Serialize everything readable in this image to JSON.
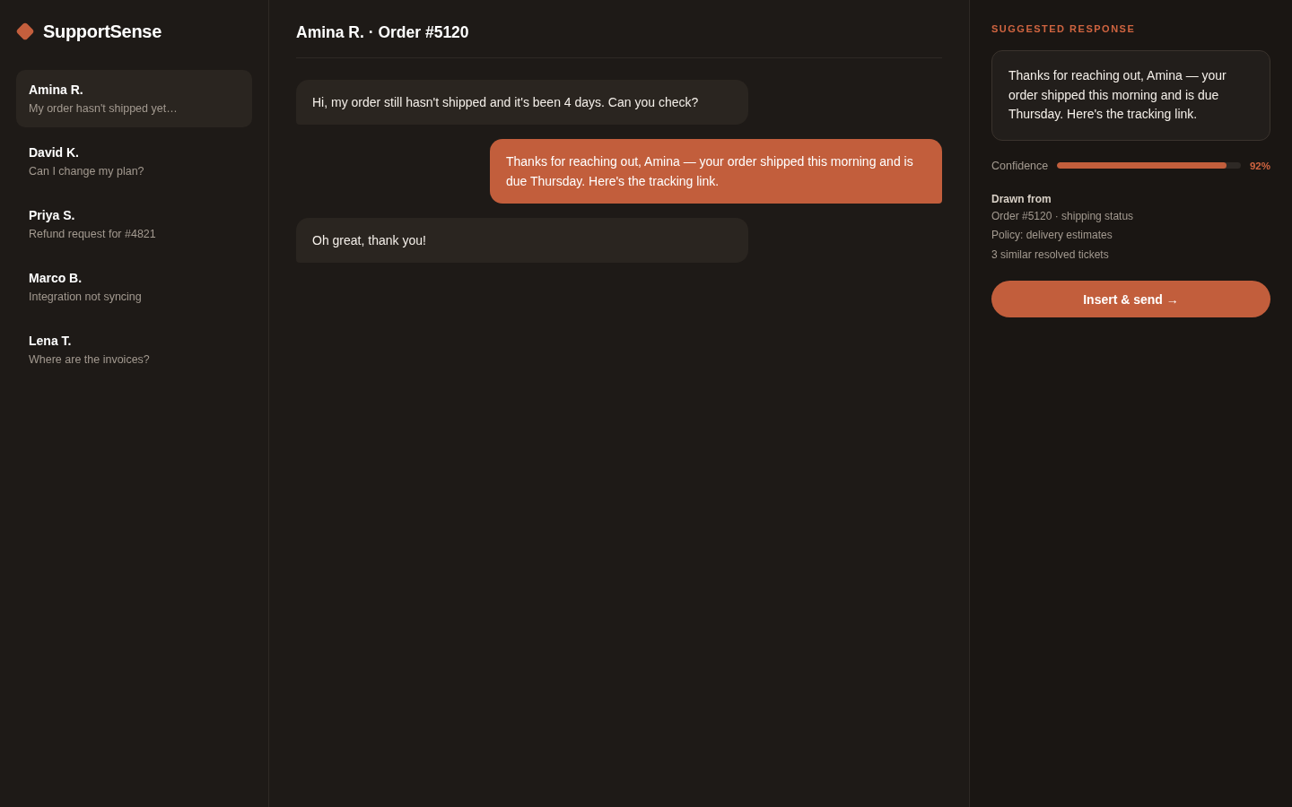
{
  "brand": {
    "name": "SupportSense"
  },
  "conversations": [
    {
      "name": "Amina R.",
      "preview": "My order hasn't shipped yet…",
      "selected": true
    },
    {
      "name": "David K.",
      "preview": "Can I change my plan?",
      "selected": false
    },
    {
      "name": "Priya S.",
      "preview": "Refund request for #4821",
      "selected": false
    },
    {
      "name": "Marco B.",
      "preview": "Integration not syncing",
      "selected": false
    },
    {
      "name": "Lena T.",
      "preview": "Where are the invoices?",
      "selected": false
    }
  ],
  "thread": {
    "title": "Amina R. · Order #5120",
    "messages": [
      {
        "kind": "customer",
        "text": "Hi, my order still hasn't shipped and it's been 4 days. Can you check?"
      },
      {
        "kind": "agent",
        "text": "Thanks for reaching out, Amina — your order shipped this morning and is due Thursday. Here's the tracking link."
      },
      {
        "kind": "customer",
        "text": "Oh great, thank you!"
      }
    ]
  },
  "suggestion": {
    "heading": "SUGGESTED RESPONSE",
    "text": "Thanks for reaching out, Amina — your order shipped this morning and is due Thursday. Here's the tracking link.",
    "confidence": {
      "label": "Confidence",
      "level": 0.92,
      "reading": "92%"
    },
    "sources": {
      "heading": "Drawn from",
      "items": [
        "Order #5120 · shipping status",
        "Policy: delivery estimates",
        "3 similar resolved tickets"
      ]
    },
    "action": "Insert & send →"
  }
}
